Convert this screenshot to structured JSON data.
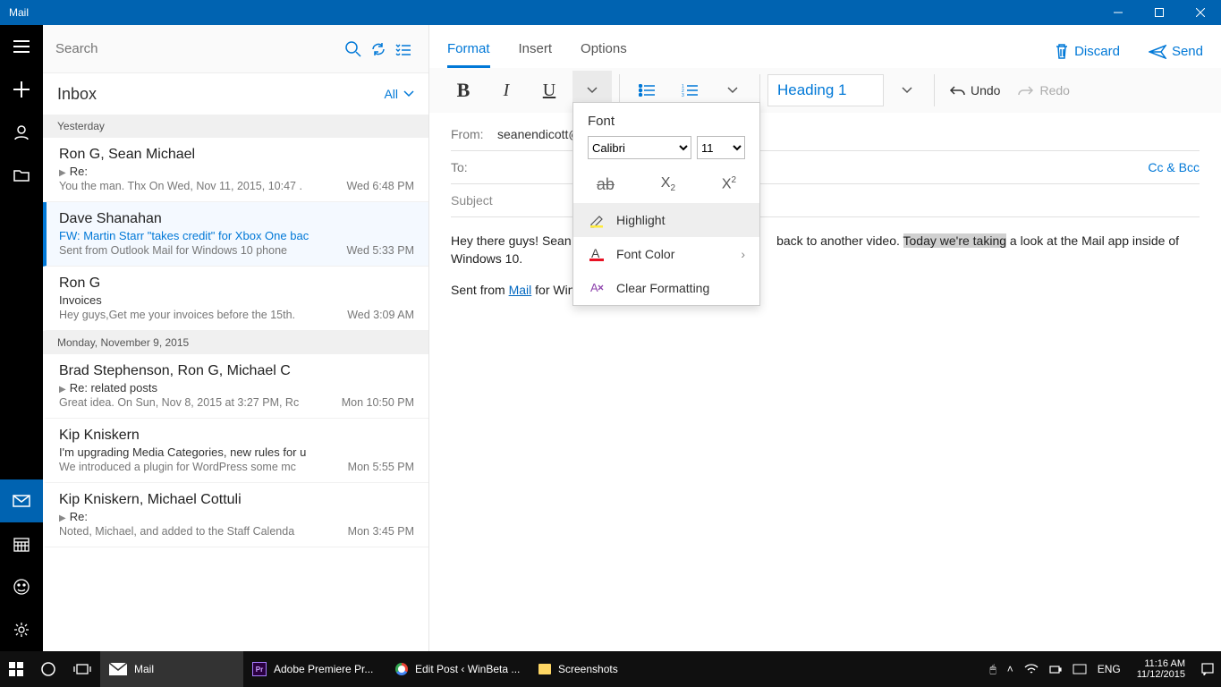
{
  "titlebar": {
    "title": "Mail"
  },
  "search": {
    "placeholder": "Search"
  },
  "inbox": {
    "title": "Inbox",
    "filter": "All"
  },
  "groups": [
    "Yesterday",
    "Monday, November 9, 2015"
  ],
  "mails": [
    {
      "from": "Ron G, Sean Michael",
      "subj": "Re:",
      "preview": "You the man. Thx On Wed, Nov 11, 2015, 10:47 .",
      "time": "Wed 6:48 PM",
      "play": true
    },
    {
      "from": "Dave Shanahan",
      "subj": "FW: Martin Starr \"takes credit\" for Xbox One bac",
      "preview": "Sent from Outlook Mail for Windows 10 phone",
      "time": "Wed 5:33 PM",
      "selected": true
    },
    {
      "from": "Ron G",
      "subj": "Invoices",
      "preview": "Hey guys,Get me your invoices before the 15th.",
      "time": "Wed 3:09 AM"
    },
    {
      "from": "Brad Stephenson, Ron G, Michael C",
      "subj": "Re: related posts",
      "preview": "Great idea. On Sun, Nov 8, 2015 at 3:27 PM, Rc",
      "time": "Mon 10:50 PM",
      "play": true
    },
    {
      "from": "Kip Kniskern",
      "subj": "I'm upgrading Media Categories, new rules for u",
      "preview": "We introduced a plugin for WordPress some mc",
      "time": "Mon 5:55 PM"
    },
    {
      "from": "Kip Kniskern, Michael Cottuli",
      "subj": "Re:",
      "preview": "Noted, Michael, and added to the Staff Calenda",
      "time": "Mon 3:45 PM",
      "play": true
    }
  ],
  "ribbon": {
    "tabs": [
      "Format",
      "Insert",
      "Options"
    ],
    "discard": "Discard",
    "send": "Send",
    "heading": "Heading 1",
    "undo": "Undo",
    "redo": "Redo"
  },
  "fontpanel": {
    "title": "Font",
    "family_options": [
      "Calibri"
    ],
    "family_selected": "Calibri",
    "size_options": [
      "11"
    ],
    "size_selected": "11",
    "highlight": "Highlight",
    "fontcolor": "Font Color",
    "clear": "Clear Formatting"
  },
  "compose": {
    "from_label": "From:",
    "from_value": "seanendicott@",
    "to_label": "To:",
    "ccbcc": "Cc & Bcc",
    "subject_placeholder": "Subject",
    "body_pre": "Hey there guys! Sean he",
    "body_mid": "back to another video. ",
    "body_highlight": "Today we're taking",
    "body_post": " a look at the Mail app inside of Windows 10.",
    "sig_pre": "Sent from ",
    "sig_link": "Mail",
    "sig_post": " for Wind"
  },
  "taskbar": {
    "mail": "Mail",
    "premiere": "Adobe Premiere Pr...",
    "edit": "Edit Post ‹ WinBeta ...",
    "shots": "Screenshots",
    "lang": "ENG",
    "time": "11:16 AM",
    "date": "11/12/2015"
  }
}
